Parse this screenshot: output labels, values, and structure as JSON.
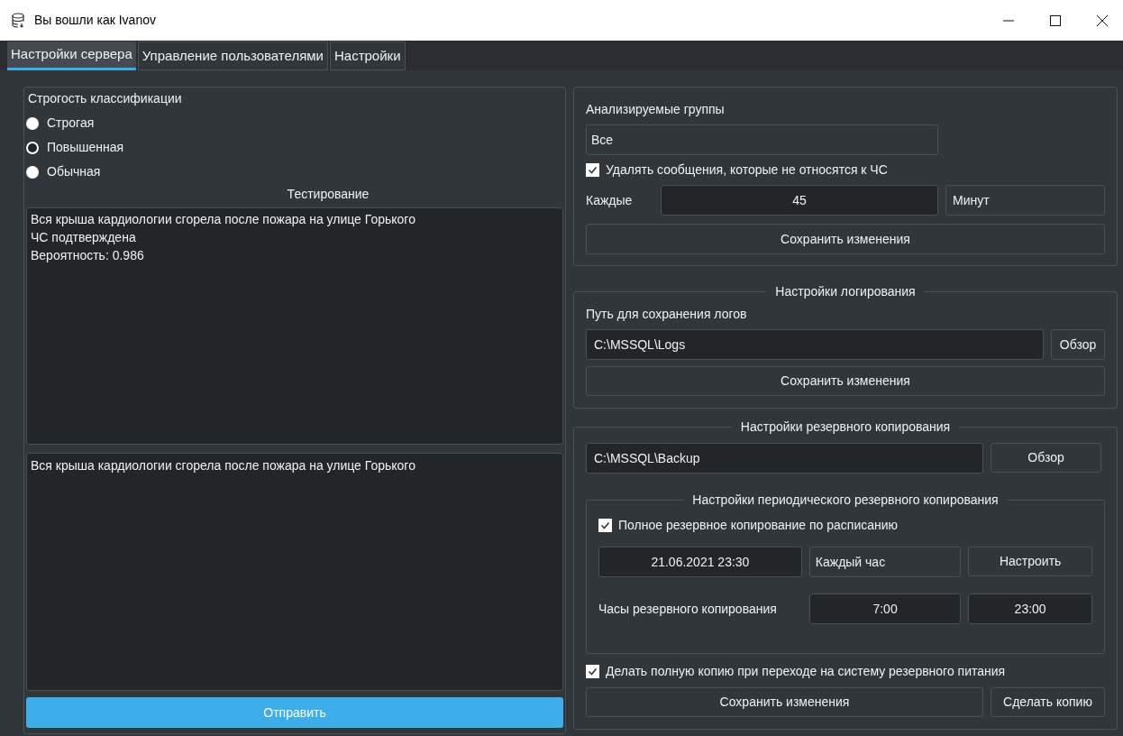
{
  "window": {
    "title": "Вы вошли как Ivanov"
  },
  "tabs": [
    {
      "label": "Настройки сервера",
      "selected": true
    },
    {
      "label": "Управление пользователями",
      "selected": false
    },
    {
      "label": "Настройки",
      "selected": false
    }
  ],
  "classification": {
    "title": "Строгость классификации",
    "options": [
      {
        "label": "Строгая",
        "selected": false
      },
      {
        "label": "Повышенная",
        "selected": true
      },
      {
        "label": "Обычная",
        "selected": false
      }
    ]
  },
  "testing": {
    "title": "Тестирование",
    "output": [
      "Вся крыша кардиологии сгорела после пожара на улице Горького",
      "ЧС подтверждена",
      "Вероятность: 0.986"
    ],
    "input": "Вся крыша кардиологии сгорела после пожара на улице Горького",
    "send_button": "Отправить"
  },
  "groups": {
    "title": "Анализируемые группы",
    "value": "Все",
    "delete_checkbox": {
      "label": "Удалять сообщения, которые не относятся к ЧС",
      "checked": true
    },
    "every_label": "Каждые",
    "interval": "45",
    "unit": "Минут",
    "save_button": "Сохранить изменения"
  },
  "logging": {
    "title": "Настройки логирования",
    "path_label": "Путь для сохранения логов",
    "path": "C:\\MSSQL\\Logs",
    "browse_button": "Обзор",
    "save_button": "Сохранить изменения"
  },
  "backup": {
    "title": "Настройки резервного копирования",
    "path": "C:\\MSSQL\\Backup",
    "browse_button": "Обзор",
    "periodic": {
      "title": "Настройки периодического резервного копирования",
      "scheduled": {
        "label": "Полное резервное копирование по расписанию",
        "checked": true
      },
      "datetime": "21.06.2021 23:30",
      "frequency": "Каждый час",
      "configure_button": "Настроить",
      "hours_label": "Часы резервного копирования",
      "from": "7:00",
      "to": "23:00"
    },
    "power_checkbox": {
      "label": "Делать полную копию при переходе на систему резервного питания",
      "checked": true
    },
    "save_button": "Сохранить изменения",
    "copy_button": "Сделать копию"
  }
}
